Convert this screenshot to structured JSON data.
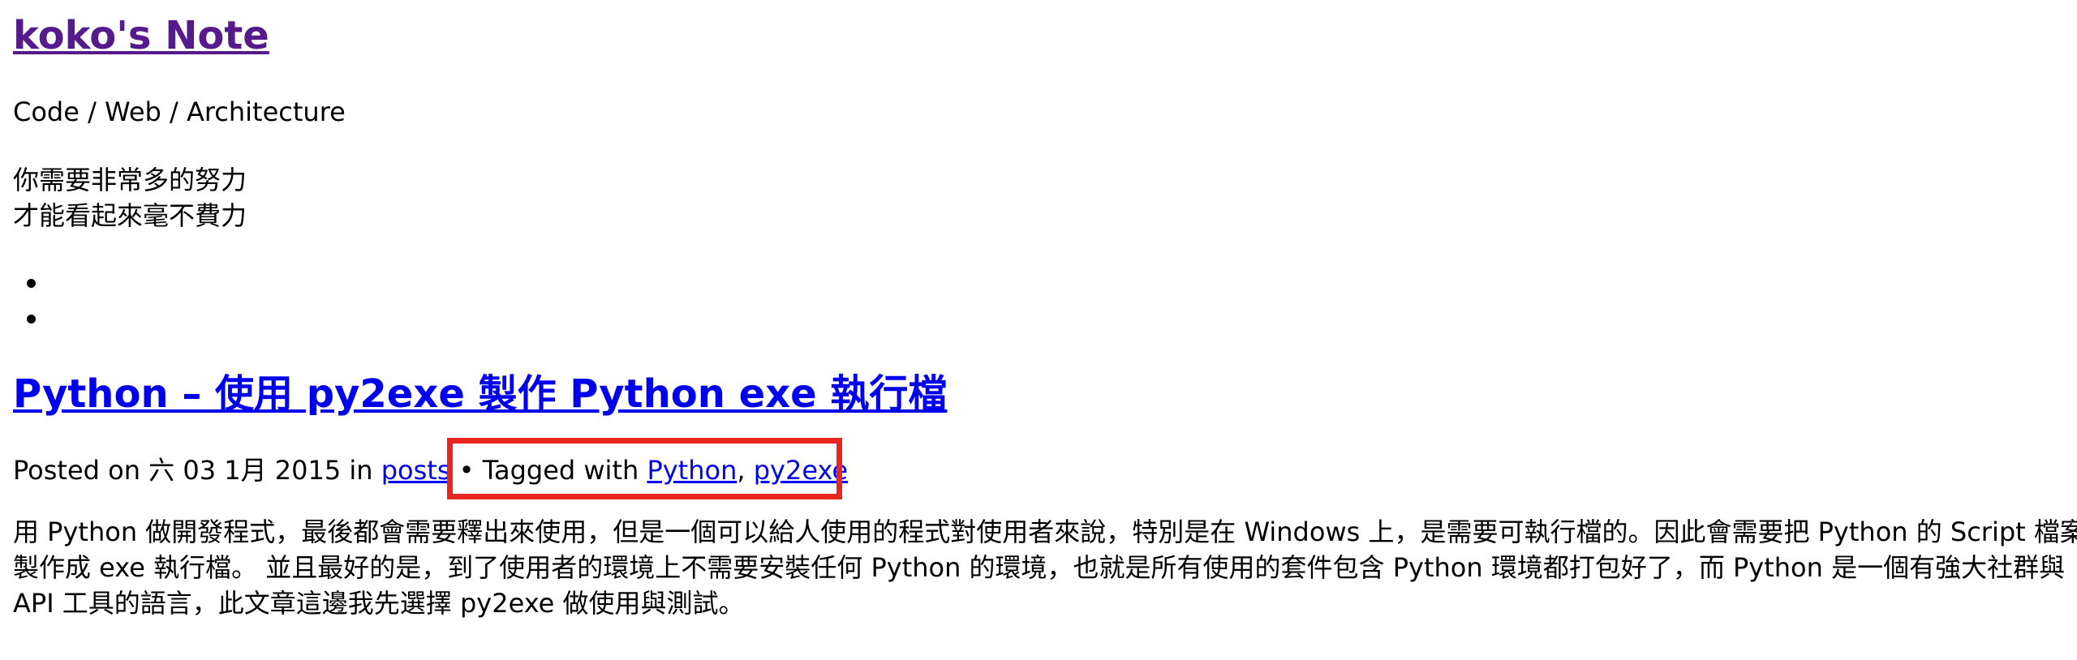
{
  "site": {
    "title": "koko's Note",
    "tagline": "Code / Web / Architecture",
    "motto": [
      "你需要非常多的努力",
      "才能看起來毫不費力"
    ]
  },
  "nav": {
    "items": [
      "",
      ""
    ]
  },
  "post": {
    "title": "Python – 使用 py2exe 製作 Python exe 執行檔",
    "meta": {
      "posted_on_label": "Posted on ",
      "date": "六 03 1月 2015",
      "in_label": " in ",
      "category": "posts",
      "separator": " • ",
      "tagged_label": "Tagged with ",
      "tags": [
        "Python",
        "py2exe"
      ],
      "tag_separator": ", "
    },
    "excerpt": [
      "用 Python 做開發程式，最後都會需要釋出來使用，但是一個可以給人使用的程式對使用者來說，特別是在 Windows 上，是需要可執行檔的。因此會需要把 Python 的 Script 檔案",
      "製作成 exe 執行檔。 並且最好的是，到了使用者的環境上不需要安裝任何 Python 的環境，也就是所有使用的套件包含 Python 環境都打包好了，而 Python 是一個有強大社群與",
      "API 工具的語言，此文章這邊我先選擇 py2exe 做使用與測試。"
    ]
  },
  "colors": {
    "link": "#0000ee",
    "visited_link": "#551a8b",
    "highlight_box": "#e8261f",
    "text": "#000000",
    "background": "#ffffff"
  }
}
